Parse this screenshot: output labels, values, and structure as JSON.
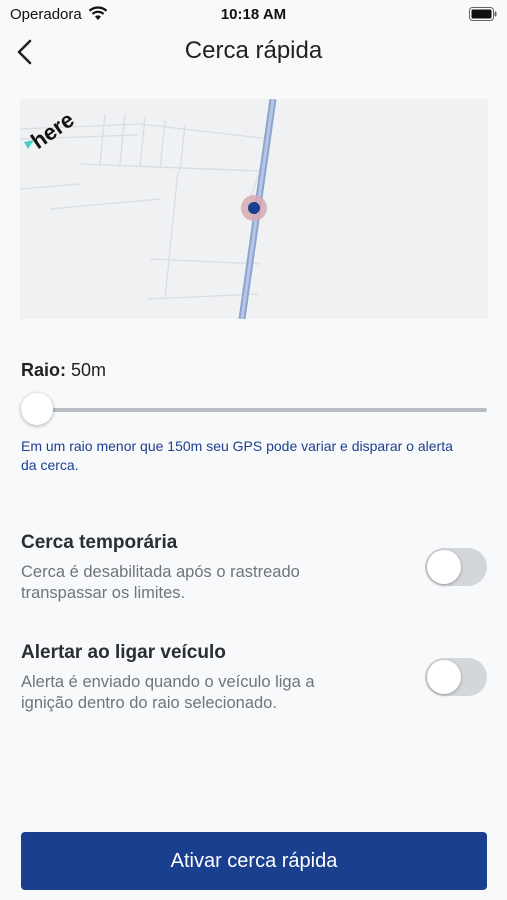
{
  "status_bar": {
    "carrier": "Operadora",
    "time": "10:18 AM",
    "wifi_icon": "wifi-icon",
    "battery_icon": "battery-icon"
  },
  "nav": {
    "back_icon": "chevron-left-icon",
    "title": "Cerca rápida"
  },
  "map": {
    "logo_text": "here",
    "pin_color": "#1a3f8e",
    "road_color": "#9fb3d9"
  },
  "radius": {
    "label": "Raio:",
    "value": "50m",
    "slider_fraction": 0.0,
    "hint": "Em um raio menor que 150m seu GPS pode variar e disparar o alerta da cerca."
  },
  "settings": [
    {
      "title": "Cerca temporária",
      "description": "Cerca é desabilitada após o rastreado transpassar os limites.",
      "enabled": false
    },
    {
      "title": "Alertar ao ligar veículo",
      "description": "Alerta é enviado quando o veículo liga a ignição dentro do raio selecionado.",
      "enabled": false
    }
  ],
  "primary_button": {
    "label": "Ativar cerca rápida",
    "color": "#1a3f8e"
  }
}
